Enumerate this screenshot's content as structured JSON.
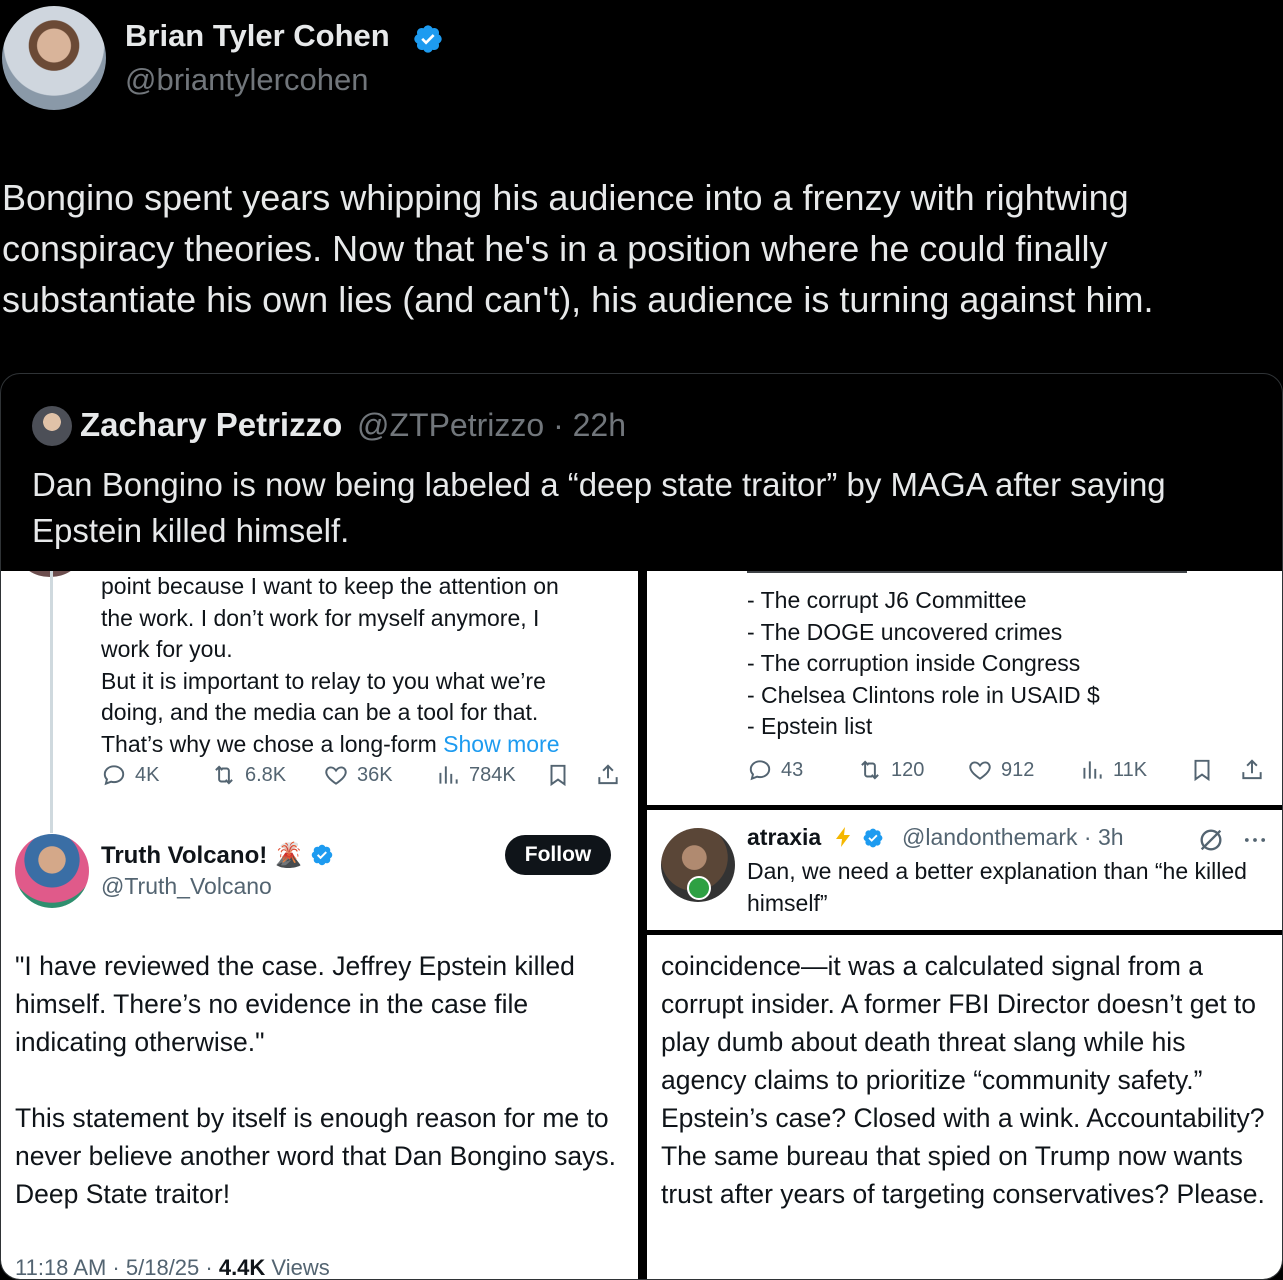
{
  "tweet": {
    "author_name": "Brian Tyler Cohen",
    "author_handle": "@briantylercohen",
    "verified": true,
    "text": "Bongino spent years whipping his audience into a frenzy with rightwing conspiracy theories. Now that he's in a position where he could finally substantiate his own lies (and can't), his audience is turning against him."
  },
  "quote": {
    "author_name": "Zachary Petrizzo",
    "handle_time": "@ZTPetrizzo · 22h",
    "text": "Dan Bongino is now being labeled a “deep state traitor” by MAGA after saying Epstein killed himself."
  },
  "panel_left": {
    "reply_lines": [
      "point because I want to keep the attention on",
      "the work. I don’t work for myself anymore, I",
      "work for you.",
      "But it is important to relay to you what we’re",
      "doing, and the media can be a tool for that.",
      "That’s why we chose a long-form"
    ],
    "show_more": "Show more",
    "actions": {
      "replies": "4K",
      "reposts": "6.8K",
      "likes": "36K",
      "views": "784K"
    },
    "tv_name": "Truth Volcano!",
    "tv_emoji": "🌋",
    "tv_handle": "@Truth_Volcano",
    "follow_label": "Follow",
    "tv_text_1": "\"I have reviewed the case. Jeffrey Epstein killed himself. There’s no evidence in the case file indicating otherwise.\"",
    "tv_text_2": "This statement by itself is enough reason for me to never believe another word that Dan Bongino says. Deep State traitor!",
    "meta_time": "11:18 AM · 5/18/25 · ",
    "meta_views_count": "4.4K",
    "meta_views_label": " Views"
  },
  "panel_right_top": {
    "list_lines": [
      "- The corrupt J6 Committee",
      "- The DOGE uncovered crimes",
      "- The corruption inside Congress",
      "- Chelsea Clintons role in USAID $",
      "- Epstein list"
    ],
    "actions": {
      "replies": "43",
      "reposts": "120",
      "likes": "912",
      "views": "11K"
    }
  },
  "panel_right_mid": {
    "name": "atraxia",
    "handle_time": "@landonthemark · 3h",
    "text": "Dan, we need a better explanation than “he killed himself”"
  },
  "panel_right_bot": {
    "text": "coincidence—it was a calculated signal from a corrupt insider. A former FBI Director doesn’t get to play dumb about death threat slang while his agency claims to prioritize “community safety.” Epstein’s case? Closed with a wink. Accountability? The same bureau that spied on Trump now wants trust after years of targeting conservatives? Please."
  },
  "colors": {
    "accent": "#1d9bf0",
    "background": "#000000",
    "muted": "#71767b"
  }
}
